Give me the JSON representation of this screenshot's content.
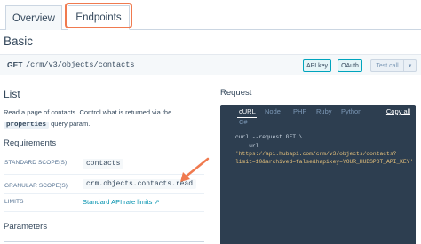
{
  "tabs": {
    "overview": "Overview",
    "endpoints": "Endpoints"
  },
  "section_title": "Basic",
  "endpoint": {
    "method": "GET",
    "path": "/crm/v3/objects/contacts",
    "api_key_label": "API key",
    "oauth_label": "OAuth",
    "test_call_label": "Test call",
    "test_call_caret": "▾"
  },
  "left": {
    "heading": "List",
    "description_pre": "Read a page of contacts. Control what is returned via the",
    "description_code": "properties",
    "description_post": "query param.",
    "requirements_heading": "Requirements",
    "rows": [
      {
        "label": "STANDARD SCOPE(S)",
        "value": "contacts"
      },
      {
        "label": "GRANULAR SCOPE(S)",
        "value": "crm.objects.contacts.read"
      },
      {
        "label": "LIMITS",
        "value": "Standard API rate limits ↗"
      }
    ],
    "parameters_heading": "Parameters"
  },
  "right": {
    "heading": "Request",
    "languages": [
      "cURL",
      "Node",
      "PHP",
      "Ruby",
      "Python",
      "C#"
    ],
    "copy_all": "Copy all",
    "code_lines": [
      "curl --request GET \\",
      "  --url",
      "'https://api.hubapi.com/crm/v3/objects/contacts?",
      "limit=10&archived=false&hapikey=YOUR_HUBSPOT_API_KEY'",
      ""
    ]
  },
  "colors": {
    "highlight": "#f07a4f",
    "code_bg": "#2d3e50",
    "link": "#0091ae",
    "auth_border": "#00a4bd"
  },
  "icons": {
    "annotation": "arrow-icon",
    "external_link": "external-link-icon"
  }
}
